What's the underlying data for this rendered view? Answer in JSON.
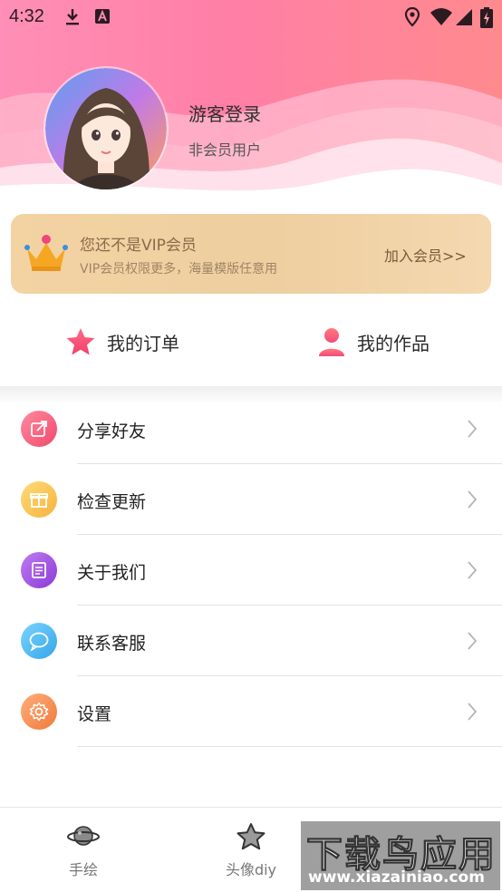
{
  "status_bar": {
    "time": "4:32",
    "left_icons": [
      "download-icon",
      "a-badge-icon"
    ],
    "right_icons": [
      "location-icon",
      "wifi-icon",
      "signal-icon",
      "battery-charging-icon"
    ]
  },
  "profile": {
    "name": "游客登录",
    "membership": "非会员用户"
  },
  "vip": {
    "title": "您还不是VIP会员",
    "description": "VIP会员权限更多，海量模版任意用",
    "join_label": "加入会员>>"
  },
  "quick_links": [
    {
      "label": "我的订单",
      "icon": "star-icon"
    },
    {
      "label": "我的作品",
      "icon": "person-icon"
    }
  ],
  "menu": [
    {
      "label": "分享好友",
      "icon": "share-icon",
      "color": "#f4607a"
    },
    {
      "label": "检查更新",
      "icon": "gift-icon",
      "color": "#f9c052"
    },
    {
      "label": "关于我们",
      "icon": "document-icon",
      "color": "#9b4fe0"
    },
    {
      "label": "联系客服",
      "icon": "chat-icon",
      "color": "#47b8f0"
    },
    {
      "label": "设置",
      "icon": "gear-icon",
      "color": "#f6894e"
    }
  ],
  "bottom_nav": [
    {
      "label": "手绘",
      "icon": "planet-icon"
    },
    {
      "label": "头像diy",
      "icon": "star-outline-icon"
    }
  ],
  "watermark": {
    "text": "下载鸟应用",
    "url": "www.xiazainiao.com"
  }
}
